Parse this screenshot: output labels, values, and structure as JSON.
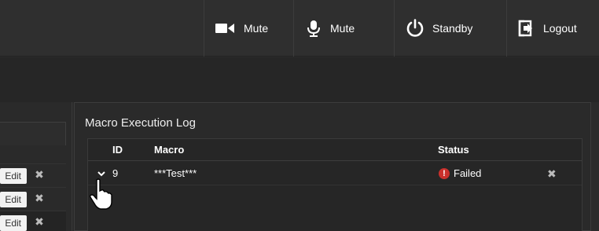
{
  "topbar": {
    "buttons": [
      {
        "icon": "video-camera-icon",
        "label": "Mute"
      },
      {
        "icon": "microphone-icon",
        "label": "Mute"
      },
      {
        "icon": "power-icon",
        "label": "Standby"
      },
      {
        "icon": "logout-icon",
        "label": "Logout"
      }
    ]
  },
  "left_panel": {
    "rows": [
      {
        "edit_label": "Edit",
        "delete_icon": "close-icon"
      },
      {
        "edit_label": "Edit",
        "delete_icon": "close-icon"
      },
      {
        "edit_label": "Edit",
        "delete_icon": "close-icon"
      }
    ]
  },
  "log_panel": {
    "title": "Macro Execution Log",
    "columns": [
      "ID",
      "Macro",
      "Status"
    ],
    "rows": [
      {
        "id": "9",
        "macro": "***Test***",
        "status": "Failed",
        "status_color": "#c9302c"
      }
    ]
  }
}
